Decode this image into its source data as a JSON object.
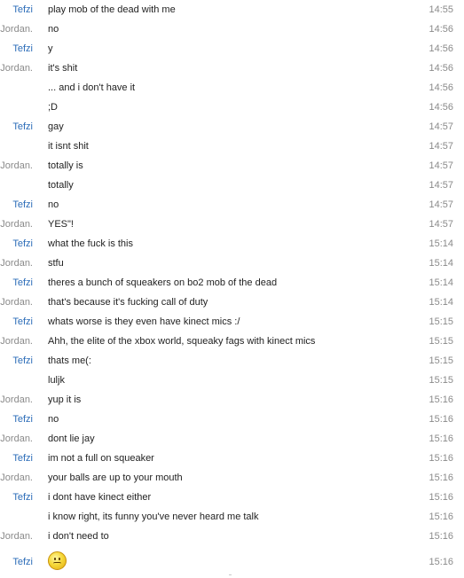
{
  "messages": [
    {
      "sender": "Tefzi",
      "text": "play mob of the dead with me",
      "time": "14:55"
    },
    {
      "sender": "Jordan.",
      "text": "no",
      "time": "14:56"
    },
    {
      "sender": "Tefzi",
      "text": "y",
      "time": "14:56"
    },
    {
      "sender": "Jordan.",
      "text": "it's shit",
      "time": "14:56"
    },
    {
      "sender": "",
      "text": "... and i don't have it",
      "time": "14:56"
    },
    {
      "sender": "",
      "text": ";D",
      "time": "14:56"
    },
    {
      "sender": "Tefzi",
      "text": "gay",
      "time": "14:57"
    },
    {
      "sender": "",
      "text": "it isnt shit",
      "time": "14:57"
    },
    {
      "sender": "Jordan.",
      "text": "totally is",
      "time": "14:57"
    },
    {
      "sender": "",
      "text": "totally",
      "time": "14:57"
    },
    {
      "sender": "Tefzi",
      "text": "no",
      "time": "14:57"
    },
    {
      "sender": "Jordan.",
      "text": "YES\"!",
      "time": "14:57"
    },
    {
      "sender": "Tefzi",
      "text": "what the fuck is this",
      "time": "15:14"
    },
    {
      "sender": "Jordan.",
      "text": "stfu",
      "time": "15:14"
    },
    {
      "sender": "Tefzi",
      "text": "theres a bunch of squeakers on bo2 mob of the dead",
      "time": "15:14"
    },
    {
      "sender": "Jordan.",
      "text": "that's because it's fucking call of duty",
      "time": "15:14"
    },
    {
      "sender": "Tefzi",
      "text": "whats worse is they even have kinect mics :/",
      "time": "15:15"
    },
    {
      "sender": "Jordan.",
      "text": "Ahh, the elite of the xbox world, squeaky fags with kinect mics",
      "time": "15:15"
    },
    {
      "sender": "Tefzi",
      "text": "thats me(:",
      "time": "15:15"
    },
    {
      "sender": "",
      "text": "luljk",
      "time": "15:15"
    },
    {
      "sender": "Jordan.",
      "text": "yup it is",
      "time": "15:16"
    },
    {
      "sender": "Tefzi",
      "text": "no",
      "time": "15:16"
    },
    {
      "sender": "Jordan.",
      "text": "dont lie jay",
      "time": "15:16"
    },
    {
      "sender": "Tefzi",
      "text": "im not a full on squeaker",
      "time": "15:16"
    },
    {
      "sender": "Jordan.",
      "text": "your balls are up to your mouth",
      "time": "15:16"
    },
    {
      "sender": "Tefzi",
      "text": "i dont have kinect either",
      "time": "15:16"
    },
    {
      "sender": "",
      "text": "i know right, its funny you've never heard me talk",
      "time": "15:16"
    },
    {
      "sender": "Jordan.",
      "text": "i don't need to",
      "time": "15:16"
    },
    {
      "sender": "Tefzi",
      "text": "",
      "icon": "smiley-emoticon-icon",
      "time": "15:16"
    }
  ],
  "colors": {
    "tefzi": "#2b6cb8",
    "jordan": "#8a8a8a",
    "message": "#222222",
    "time": "#8a8a8a"
  }
}
